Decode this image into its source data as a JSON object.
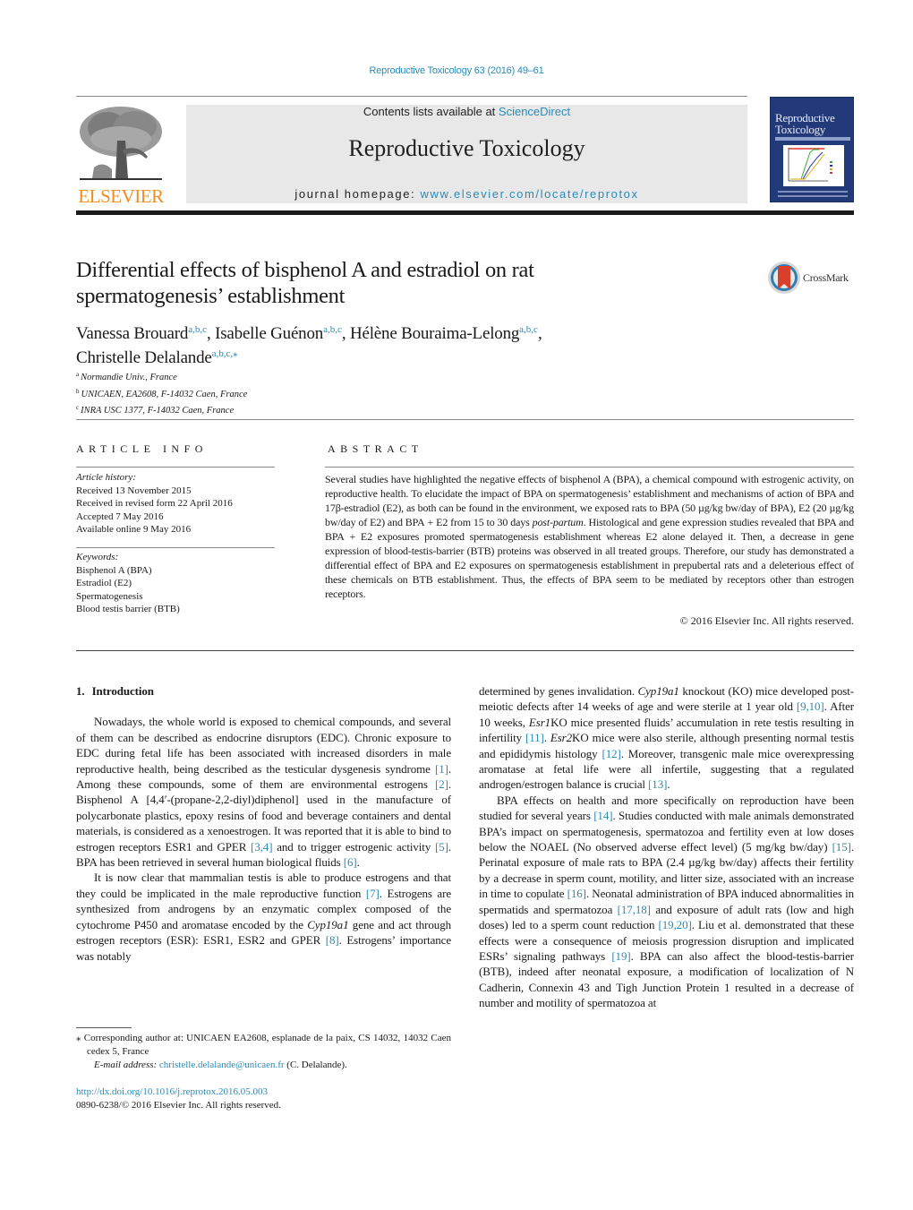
{
  "header": {
    "running_head": "Reproductive Toxicology 63 (2016) 49–61",
    "publisher_logo_text": "ELSEVIER",
    "contents_prefix": "Contents lists available at ",
    "contents_link": "ScienceDirect",
    "journal_name": "Reproductive Toxicology",
    "homepage_prefix": "journal homepage: ",
    "homepage_link": "www.elsevier.com/locate/reprotox",
    "cover_title_line1": "Reproductive",
    "cover_title_line2": "Toxicology",
    "brand_color": "#f08d1e",
    "link_color": "#2a8ab5"
  },
  "article": {
    "title_line1": "Differential effects of bisphenol A and estradiol on rat",
    "title_line2": "spermatogenesis’ establishment",
    "crossmark_label": "CrossMark",
    "authors": [
      {
        "name": "Vanessa Brouard",
        "affil": "a,b,c",
        "sep": ", "
      },
      {
        "name": "Isabelle Guénon",
        "affil": "a,b,c",
        "sep": ", "
      },
      {
        "name": "Hélène Bouraima-Lelong",
        "affil": "a,b,c",
        "sep": ","
      },
      {
        "name": "Christelle Delalande",
        "affil": "a,b,c,⁎",
        "sep": ""
      }
    ],
    "affiliations": [
      {
        "key": "a",
        "text": "Normandie Univ., France"
      },
      {
        "key": "b",
        "text": "UNICAEN, EA2608, F-14032 Caen, France"
      },
      {
        "key": "c",
        "text": "INRA USC 1377, F-14032 Caen, France"
      }
    ]
  },
  "article_info": {
    "heading": "ARTICLE INFO",
    "history_label": "Article history:",
    "history": [
      "Received 13 November 2015",
      "Received in revised form 22 April 2016",
      "Accepted 7 May 2016",
      "Available online 9 May 2016"
    ],
    "keywords_label": "Keywords:",
    "keywords": [
      "Bisphenol A (BPA)",
      "Estradiol (E2)",
      "Spermatogenesis",
      "Blood testis barrier (BTB)"
    ]
  },
  "abstract": {
    "heading": "ABSTRACT",
    "part1": "Several studies have highlighted the negative effects of bisphenol A (BPA), a chemical compound with estrogenic activity, on reproductive health. To elucidate the impact of BPA on spermatogenesis’ establishment and mechanisms of action of BPA and 17β-estradiol (E2), as both can be found in the environment, we exposed rats to BPA (50 µg/kg bw/day of BPA), E2 (20 µg/kg bw/day of E2) and BPA + E2 from 15 to 30 days ",
    "part1_italic": "post-partum",
    "part2": ". Histological and gene expression studies revealed that BPA and BPA + E2 exposures promoted spermatogenesis establishment whereas E2 alone delayed it. Then, a decrease in gene expression of blood-testis-barrier (BTB) proteins was observed in all treated groups. Therefore, our study has demonstrated a differential effect of BPA and E2 exposures on spermatogenesis establishment in prepubertal rats and a deleterious effect of these chemicals on BTB establishment. Thus, the effects of BPA seem to be mediated by receptors other than estrogen receptors.",
    "copyright": "© 2016 Elsevier Inc. All rights reserved."
  },
  "body": {
    "section_number": "1.",
    "section_title": "Introduction",
    "left_p1": [
      {
        "t": "Nowadays, the whole world is exposed to chemical compounds, and several of them can be described as endocrine disruptors (EDC). Chronic exposure to EDC during fetal life has been associated with increased disorders in male reproductive health, being described as the testicular dysgenesis syndrome "
      },
      {
        "ref": "[1]"
      },
      {
        "t": ". Among these compounds, some of them are environmental estrogens "
      },
      {
        "ref": "[2]"
      },
      {
        "t": ". Bisphenol A [4,4′-(propane-2,2-diyl)diphenol] used in the manufacture of polycarbonate plastics, epoxy resins of food and beverage containers and dental materials, is considered as a xenoestrogen. It was reported that it is able to bind to estrogen receptors ESR1 and GPER "
      },
      {
        "ref": "[3,4]"
      },
      {
        "t": " and to trigger estrogenic activity "
      },
      {
        "ref": "[5]"
      },
      {
        "t": ". BPA has been retrieved in several human biological fluids "
      },
      {
        "ref": "[6]"
      },
      {
        "t": "."
      }
    ],
    "left_p2": [
      {
        "t": "It is now clear that mammalian testis is able to produce estrogens and that they could be implicated in the male reproductive function "
      },
      {
        "ref": "[7]"
      },
      {
        "t": ". Estrogens are synthesized from androgens by an enzymatic complex composed of the cytochrome P450 and aromatase encoded by the "
      },
      {
        "i": "Cyp19a1"
      },
      {
        "t": " gene and act through estrogen receptors (ESR): ESR1, ESR2 and GPER "
      },
      {
        "ref": "[8]"
      },
      {
        "t": ". Estrogens’ importance was notably"
      }
    ],
    "right_p1": [
      {
        "t": "determined by genes invalidation. "
      },
      {
        "i": "Cyp19a1"
      },
      {
        "t": " knockout (KO) mice developed post-meiotic defects after 14 weeks of age and were sterile at 1 year old "
      },
      {
        "ref": "[9,10]"
      },
      {
        "t": ". After 10 weeks, "
      },
      {
        "i": "Esr1"
      },
      {
        "t": "KO mice presented fluids’ accumulation in rete testis resulting in infertility "
      },
      {
        "ref": "[11]"
      },
      {
        "t": ". "
      },
      {
        "i": "Esr2"
      },
      {
        "t": "KO mice were also sterile, although presenting normal testis and epididymis histology "
      },
      {
        "ref": "[12]"
      },
      {
        "t": ". Moreover, transgenic male mice overexpressing aromatase at fetal life were all infertile, suggesting that a regulated androgen/estrogen balance is crucial "
      },
      {
        "ref": "[13]"
      },
      {
        "t": "."
      }
    ],
    "right_p2": [
      {
        "t": "BPA effects on health and more specifically on reproduction have been studied for several years "
      },
      {
        "ref": "[14]"
      },
      {
        "t": ". Studies conducted with male animals demonstrated BPA’s impact on spermatogenesis, spermatozoa and fertility even at low doses below the NOAEL (No observed adverse effect level) (5 mg/kg bw/day) "
      },
      {
        "ref": "[15]"
      },
      {
        "t": ". Perinatal exposure of male rats to BPA (2.4 µg/kg bw/day) affects their fertility by a decrease in sperm count, motility, and litter size, associated with an increase in time to copulate "
      },
      {
        "ref": "[16]"
      },
      {
        "t": ". Neonatal administration of BPA induced abnormalities in spermatids and spermatozoa "
      },
      {
        "ref": "[17,18]"
      },
      {
        "t": " and exposure of adult rats (low and high doses) led to a sperm count reduction "
      },
      {
        "ref": "[19,20]"
      },
      {
        "t": ". Liu et al. demonstrated that these effects were a consequence of meiosis progression disruption and implicated ESRs’ signaling pathways "
      },
      {
        "ref": "[19]"
      },
      {
        "t": ". BPA can also affect the blood-testis-barrier (BTB), indeed after neonatal exposure, a modification of localization of N Cadherin, Connexin 43 and Tigh Junction Protein 1 resulted in a decrease of number and motility of spermatozoa at"
      }
    ]
  },
  "footnotes": {
    "corresponding": "⁎ Corresponding author at: UNICAEN EA2608, esplanade de la paix, CS 14032, 14032 Caen cedex 5, France",
    "email_label": "E-mail address: ",
    "email": "christelle.delalande@unicaen.fr",
    "email_suffix": " (C. Delalande).",
    "doi": "http://dx.doi.org/10.1016/j.reprotox.2016.05.003",
    "issn_line": "0890-6238/© 2016 Elsevier Inc. All rights reserved."
  }
}
